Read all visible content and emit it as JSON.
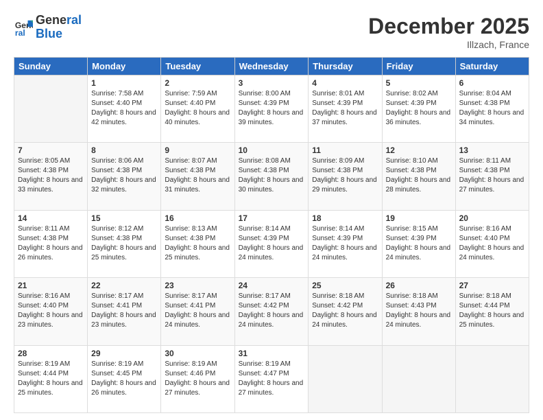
{
  "header": {
    "logo_line1": "General",
    "logo_line2": "Blue",
    "month": "December 2025",
    "location": "Illzach, France"
  },
  "weekdays": [
    "Sunday",
    "Monday",
    "Tuesday",
    "Wednesday",
    "Thursday",
    "Friday",
    "Saturday"
  ],
  "weeks": [
    [
      {
        "day": "",
        "sunrise": "",
        "sunset": "",
        "daylight": ""
      },
      {
        "day": "1",
        "sunrise": "7:58 AM",
        "sunset": "4:40 PM",
        "daylight": "8 hours and 42 minutes."
      },
      {
        "day": "2",
        "sunrise": "7:59 AM",
        "sunset": "4:40 PM",
        "daylight": "8 hours and 40 minutes."
      },
      {
        "day": "3",
        "sunrise": "8:00 AM",
        "sunset": "4:39 PM",
        "daylight": "8 hours and 39 minutes."
      },
      {
        "day": "4",
        "sunrise": "8:01 AM",
        "sunset": "4:39 PM",
        "daylight": "8 hours and 37 minutes."
      },
      {
        "day": "5",
        "sunrise": "8:02 AM",
        "sunset": "4:39 PM",
        "daylight": "8 hours and 36 minutes."
      },
      {
        "day": "6",
        "sunrise": "8:04 AM",
        "sunset": "4:38 PM",
        "daylight": "8 hours and 34 minutes."
      }
    ],
    [
      {
        "day": "7",
        "sunrise": "8:05 AM",
        "sunset": "4:38 PM",
        "daylight": "8 hours and 33 minutes."
      },
      {
        "day": "8",
        "sunrise": "8:06 AM",
        "sunset": "4:38 PM",
        "daylight": "8 hours and 32 minutes."
      },
      {
        "day": "9",
        "sunrise": "8:07 AM",
        "sunset": "4:38 PM",
        "daylight": "8 hours and 31 minutes."
      },
      {
        "day": "10",
        "sunrise": "8:08 AM",
        "sunset": "4:38 PM",
        "daylight": "8 hours and 30 minutes."
      },
      {
        "day": "11",
        "sunrise": "8:09 AM",
        "sunset": "4:38 PM",
        "daylight": "8 hours and 29 minutes."
      },
      {
        "day": "12",
        "sunrise": "8:10 AM",
        "sunset": "4:38 PM",
        "daylight": "8 hours and 28 minutes."
      },
      {
        "day": "13",
        "sunrise": "8:11 AM",
        "sunset": "4:38 PM",
        "daylight": "8 hours and 27 minutes."
      }
    ],
    [
      {
        "day": "14",
        "sunrise": "8:11 AM",
        "sunset": "4:38 PM",
        "daylight": "8 hours and 26 minutes."
      },
      {
        "day": "15",
        "sunrise": "8:12 AM",
        "sunset": "4:38 PM",
        "daylight": "8 hours and 25 minutes."
      },
      {
        "day": "16",
        "sunrise": "8:13 AM",
        "sunset": "4:38 PM",
        "daylight": "8 hours and 25 minutes."
      },
      {
        "day": "17",
        "sunrise": "8:14 AM",
        "sunset": "4:39 PM",
        "daylight": "8 hours and 24 minutes."
      },
      {
        "day": "18",
        "sunrise": "8:14 AM",
        "sunset": "4:39 PM",
        "daylight": "8 hours and 24 minutes."
      },
      {
        "day": "19",
        "sunrise": "8:15 AM",
        "sunset": "4:39 PM",
        "daylight": "8 hours and 24 minutes."
      },
      {
        "day": "20",
        "sunrise": "8:16 AM",
        "sunset": "4:40 PM",
        "daylight": "8 hours and 24 minutes."
      }
    ],
    [
      {
        "day": "21",
        "sunrise": "8:16 AM",
        "sunset": "4:40 PM",
        "daylight": "8 hours and 23 minutes."
      },
      {
        "day": "22",
        "sunrise": "8:17 AM",
        "sunset": "4:41 PM",
        "daylight": "8 hours and 23 minutes."
      },
      {
        "day": "23",
        "sunrise": "8:17 AM",
        "sunset": "4:41 PM",
        "daylight": "8 hours and 24 minutes."
      },
      {
        "day": "24",
        "sunrise": "8:17 AM",
        "sunset": "4:42 PM",
        "daylight": "8 hours and 24 minutes."
      },
      {
        "day": "25",
        "sunrise": "8:18 AM",
        "sunset": "4:42 PM",
        "daylight": "8 hours and 24 minutes."
      },
      {
        "day": "26",
        "sunrise": "8:18 AM",
        "sunset": "4:43 PM",
        "daylight": "8 hours and 24 minutes."
      },
      {
        "day": "27",
        "sunrise": "8:18 AM",
        "sunset": "4:44 PM",
        "daylight": "8 hours and 25 minutes."
      }
    ],
    [
      {
        "day": "28",
        "sunrise": "8:19 AM",
        "sunset": "4:44 PM",
        "daylight": "8 hours and 25 minutes."
      },
      {
        "day": "29",
        "sunrise": "8:19 AM",
        "sunset": "4:45 PM",
        "daylight": "8 hours and 26 minutes."
      },
      {
        "day": "30",
        "sunrise": "8:19 AM",
        "sunset": "4:46 PM",
        "daylight": "8 hours and 27 minutes."
      },
      {
        "day": "31",
        "sunrise": "8:19 AM",
        "sunset": "4:47 PM",
        "daylight": "8 hours and 27 minutes."
      },
      {
        "day": "",
        "sunrise": "",
        "sunset": "",
        "daylight": ""
      },
      {
        "day": "",
        "sunrise": "",
        "sunset": "",
        "daylight": ""
      },
      {
        "day": "",
        "sunrise": "",
        "sunset": "",
        "daylight": ""
      }
    ]
  ]
}
